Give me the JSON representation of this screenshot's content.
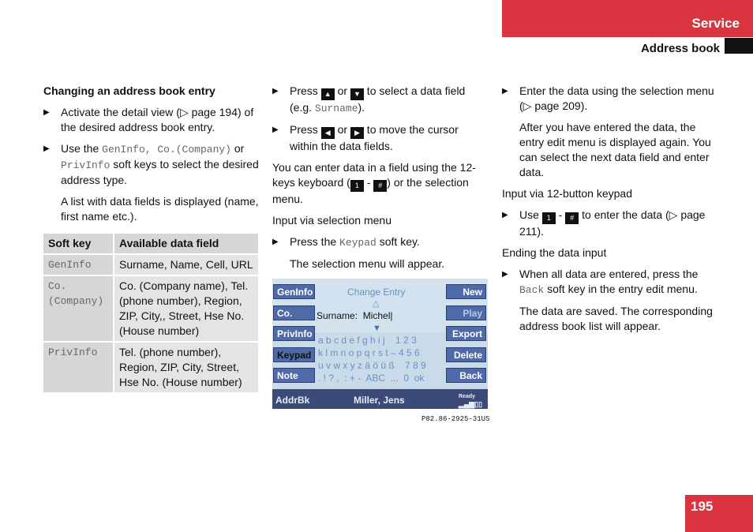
{
  "header": {
    "section": "Service",
    "subsection": "Address book",
    "page_number": "195"
  },
  "col1": {
    "heading": "Changing an address book entry",
    "step1": "Activate the detail view (▷ page 194) of the desired address book entry.",
    "step2_pre": "Use the ",
    "step2_k1": "GenInfo, Co.(Company)",
    "step2_mid": " or ",
    "step2_k2": "PrivInfo",
    "step2_post": " soft keys to select the desired address type.",
    "note": "A list with data fields is displayed (name, first name etc.).",
    "table": {
      "headers": [
        "Soft key",
        "Available data field"
      ],
      "rows": [
        [
          "GenInfo",
          "Surname, Name, Cell, URL"
        ],
        [
          "Co. (Company)",
          "Co. (Company name), Tel. (phone number), Region, ZIP, City,, Street, Hse No. (House number)"
        ],
        [
          "PrivInfo",
          "Tel. (phone number), Region, ZIP, City, Street, Hse No. (House number)"
        ]
      ]
    }
  },
  "col2": {
    "s1_pre": "Press ",
    "s1_or": " or ",
    "s1_post": " to select a data field (e.g. ",
    "s1_k": "Surname",
    "s1_end": ").",
    "s2_pre": "Press ",
    "s2_or": " or ",
    "s2_post": " to move the cursor within the data fields.",
    "p1_pre": "You can enter data in a field using the 12-keys keyboard (",
    "p1_dash": " - ",
    "p1_post": ") or the selection menu.",
    "p2": "Input via selection menu",
    "s3_pre": "Press the ",
    "s3_k": "Keypad",
    "s3_post": " soft key.",
    "s3_note": "The selection menu will appear.",
    "screen": {
      "title": "Change Entry",
      "left_keys": [
        "GenInfo",
        "Co.",
        "PrivInfo",
        "Keypad",
        "Note"
      ],
      "right_keys": [
        "New",
        "Play",
        "Export",
        "Delete",
        "Back"
      ],
      "field_label": "Surname:",
      "field_value": "Michel",
      "keyboard": [
        "a b c d e f g h i j    1 2 3",
        "k l m n o p q r s t – 4 5 6",
        "u v w x y z ä ö ü ß    7 8 9",
        ". ! ? ,  : + -  ABC  ...  0  ok"
      ],
      "status_left": "AddrBk",
      "status_center": "Miller, Jens",
      "status_ready": "Ready"
    },
    "caption": "P82.86-2925-31US",
    "icons": {
      "up": "triangle-up",
      "down": "triangle-down",
      "left": "triangle-left",
      "right": "triangle-right",
      "key1": "1",
      "keyhash": "#"
    }
  },
  "col3": {
    "s1": "Enter the data using the selection menu (▷ page 209).",
    "n1": "After you have entered the data, the entry edit menu is displayed again. You can select the next data field and enter data.",
    "p1": "Input via 12-button keypad",
    "s2_pre": "Use ",
    "s2_dash": " - ",
    "s2_post": " to enter the data (▷ page 211).",
    "p2": "Ending the data input",
    "s3_pre": "When all data are entered, press the ",
    "s3_k": "Back",
    "s3_post": " soft key in the entry edit menu.",
    "n2": "The data are saved. The corresponding address book list will appear."
  }
}
